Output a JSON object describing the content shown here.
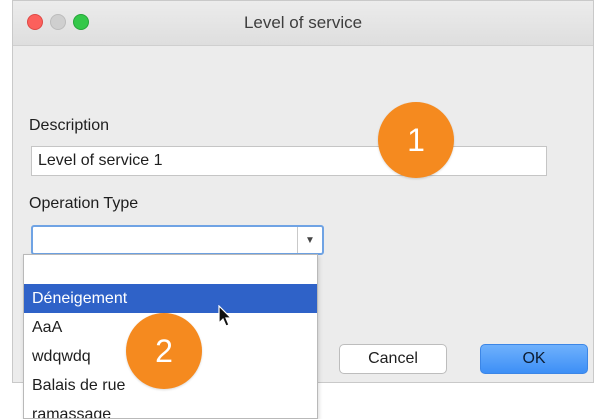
{
  "window": {
    "title": "Level of service"
  },
  "form": {
    "description_label": "Description",
    "description_value": "Level of service 1",
    "operation_type_label": "Operation Type",
    "operation_type_value": ""
  },
  "dropdown": {
    "items": [
      "",
      "Déneigement",
      "AaA",
      "wdqwdq",
      "Balais de rue",
      "ramassage"
    ],
    "selected_index": 1
  },
  "buttons": {
    "cancel_label": "Cancel",
    "ok_label": "OK"
  },
  "annotations": {
    "badge_1": "1",
    "badge_2": "2"
  },
  "icons": {
    "close": "close-traffic-light",
    "minimize": "minimize-traffic-light",
    "maximize": "maximize-traffic-light",
    "combo_arrow": "chevron-down-icon",
    "cursor": "pointer-cursor-icon"
  },
  "colors": {
    "selection": "#2f62c8",
    "badge": "#f58a1f",
    "ok_button": "#3d8ff6",
    "focus_ring": "#6fa3e4"
  }
}
